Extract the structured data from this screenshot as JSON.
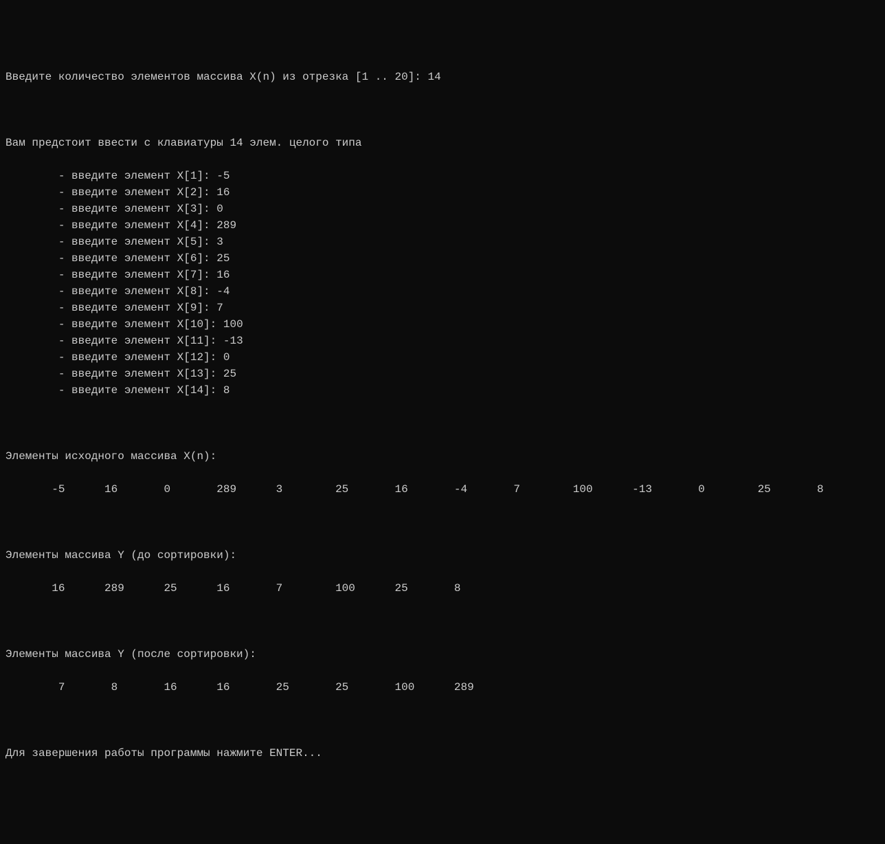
{
  "prompt_count": "Введите количество элементов массива X(n) из отрезка [1 .. 20]: ",
  "count": "14",
  "prompt_input_header": "Вам предстоит ввести с клавиатуры 14 элем. целого типа",
  "elements": [
    {
      "label": "        - введите элемент X[1]: ",
      "value": "-5"
    },
    {
      "label": "        - введите элемент X[2]: ",
      "value": "16"
    },
    {
      "label": "        - введите элемент X[3]: ",
      "value": "0"
    },
    {
      "label": "        - введите элемент X[4]: ",
      "value": "289"
    },
    {
      "label": "        - введите элемент X[5]: ",
      "value": "3"
    },
    {
      "label": "        - введите элемент X[6]: ",
      "value": "25"
    },
    {
      "label": "        - введите элемент X[7]: ",
      "value": "16"
    },
    {
      "label": "        - введите элемент X[8]: ",
      "value": "-4"
    },
    {
      "label": "        - введите элемент X[9]: ",
      "value": "7"
    },
    {
      "label": "        - введите элемент X[10]: ",
      "value": "100"
    },
    {
      "label": "        - введите элемент X[11]: ",
      "value": "-13"
    },
    {
      "label": "        - введите элемент X[12]: ",
      "value": "0"
    },
    {
      "label": "        - введите элемент X[13]: ",
      "value": "25"
    },
    {
      "label": "        - введите элемент X[14]: ",
      "value": "8"
    }
  ],
  "section_x_header": "Элементы исходного массива X(n):",
  "section_x_values": "       -5      16       0       289      3        25       16       -4       7        100      -13       0        25       8",
  "section_y_before_header": "Элементы массива Y (до сортировки):",
  "section_y_before_values": "       16      289      25      16       7        100      25       8",
  "section_y_after_header": "Элементы массива Y (после сортировки):",
  "section_y_after_values": "        7       8       16      16       25       25       100      289",
  "footer": "Для завершения работы программы нажмите ENTER..."
}
